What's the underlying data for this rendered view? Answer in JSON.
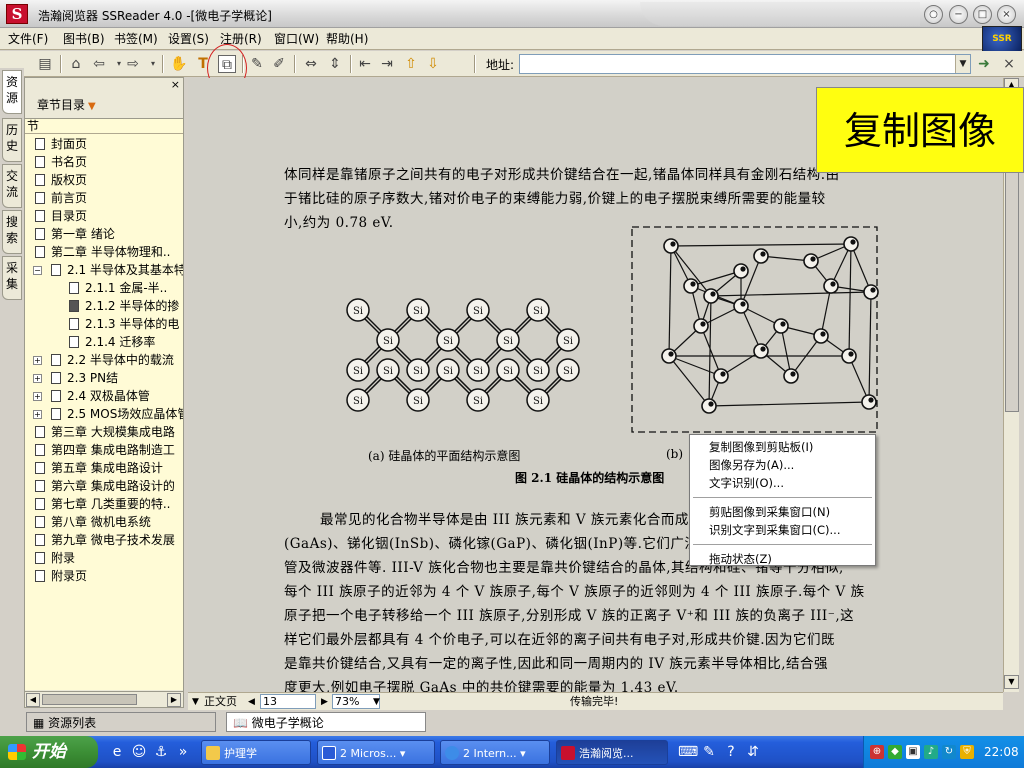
{
  "window": {
    "title": "浩瀚阅览器 SSReader 4.0 -[微电子学概论]",
    "logo_glyph": "S"
  },
  "logo_badge_text": "SSR",
  "menubar": [
    "文件(F)",
    "图书(B)",
    "书签(M)",
    "设置(S)",
    "注册(R)",
    "窗口(W)",
    "帮助(H)"
  ],
  "toolbar": {
    "address_label": "地址:",
    "address_value": ""
  },
  "vertical_tabs": [
    "资源",
    "历史",
    "交流",
    "搜索",
    "采集"
  ],
  "sidebar": {
    "dropdown_label": "章节目录",
    "tree_header": "节",
    "items": [
      {
        "label": "封面页",
        "level": 0,
        "expander": ""
      },
      {
        "label": "书名页",
        "level": 0,
        "expander": ""
      },
      {
        "label": "版权页",
        "level": 0,
        "expander": ""
      },
      {
        "label": "前言页",
        "level": 0,
        "expander": ""
      },
      {
        "label": "目录页",
        "level": 0,
        "expander": ""
      },
      {
        "label": "第一章 绪论",
        "level": 0,
        "expander": ""
      },
      {
        "label": "第二章 半导体物理和..",
        "level": 0,
        "expander": ""
      },
      {
        "label": "2.1 半导体及其基本特",
        "level": 1,
        "expander": "−"
      },
      {
        "label": "2.1.1 金属-半..",
        "level": 2,
        "expander": ""
      },
      {
        "label": "2.1.2 半导体的掺",
        "level": 2,
        "expander": "",
        "selected": true
      },
      {
        "label": "2.1.3 半导体的电",
        "level": 2,
        "expander": ""
      },
      {
        "label": "2.1.4 迁移率",
        "level": 2,
        "expander": ""
      },
      {
        "label": "2.2 半导体中的载流",
        "level": 1,
        "expander": "+"
      },
      {
        "label": "2.3 PN结",
        "level": 1,
        "expander": "+"
      },
      {
        "label": "2.4 双极晶体管",
        "level": 1,
        "expander": "+"
      },
      {
        "label": "2.5 MOS场效应晶体管",
        "level": 1,
        "expander": "+"
      },
      {
        "label": "第三章 大规模集成电路",
        "level": 0,
        "expander": ""
      },
      {
        "label": "第四章 集成电路制造工",
        "level": 0,
        "expander": ""
      },
      {
        "label": "第五章 集成电路设计",
        "level": 0,
        "expander": ""
      },
      {
        "label": "第六章 集成电路设计的",
        "level": 0,
        "expander": ""
      },
      {
        "label": "第七章 几类重要的特..",
        "level": 0,
        "expander": ""
      },
      {
        "label": "第八章 微机电系统",
        "level": 0,
        "expander": ""
      },
      {
        "label": "第九章 微电子技术发展",
        "level": 0,
        "expander": ""
      },
      {
        "label": "附录",
        "level": 0,
        "expander": ""
      },
      {
        "label": "附录页",
        "level": 0,
        "expander": ""
      }
    ]
  },
  "page": {
    "para1": [
      "体同样是靠锗原子之间共有的电子对形成共价键结合在一起,锗晶体同样具有金刚石结构.由",
      "于锗比硅的原子序数大,锗对价电子的束缚能力弱,价键上的电子摆脱束缚所需要的能量较",
      "小,约为 0.78 eV."
    ],
    "atom_label": "Si",
    "caption_a": "(a) 硅晶体的平面结构示意图",
    "caption_b": "(b)",
    "figure_caption": "图 2.1    硅晶体的结构示意图",
    "para2": [
      "最常见的化合物半导体是由 III 族元素和 V 族元素化合而成的,如砷化镓",
      "(GaAs)、锑化铟(InSb)、磷化镓(GaP)、磷化铟(InP)等.它们广泛用于发光器件、激光",
      "管及微波器件等. III-V 族化合物也主要是靠共价键结合的晶体,其结构和硅、锗等十分相似,",
      "每个 III 族原子的近邻为 4 个 V 族原子,每个 V 族原子的近邻则为 4 个 III 族原子.每个 V 族",
      "原子把一个电子转移给一个 III 族原子,分别形成 V 族的正离子 V⁺和 III 族的负离子 III⁻,这",
      "样它们最外层都具有 4 个价电子,可以在近邻的离子间共有电子对,形成共价键.因为它们既",
      "是靠共价键结合,又具有一定的离子性,因此和同一周期内的 IV 族元素半导体相比,结合强",
      "度更大,例如电子摆脱 GaAs 中的共价键需要的能量为 1.43 eV."
    ]
  },
  "copy_bubble": "复制图像",
  "context_menu": {
    "group1": [
      "复制图像到剪贴板(I)",
      "图像另存为(A)...",
      "文字识别(O)..."
    ],
    "group2": [
      "剪贴图像到采集窗口(N)",
      "识别文字到采集窗口(C)..."
    ],
    "group3": [
      "拖动状态(Z)"
    ]
  },
  "status": {
    "mode": "正文页",
    "page": "13",
    "zoom": "73%",
    "message": "传输完毕!"
  },
  "bottom_tabs": [
    "资源列表",
    "微电子学概论"
  ],
  "taskbar": {
    "start": "开始",
    "tasks": [
      "护理学",
      "2 Micros...",
      "2 Intern...",
      "浩瀚阅览..."
    ],
    "clock": "22:08"
  }
}
